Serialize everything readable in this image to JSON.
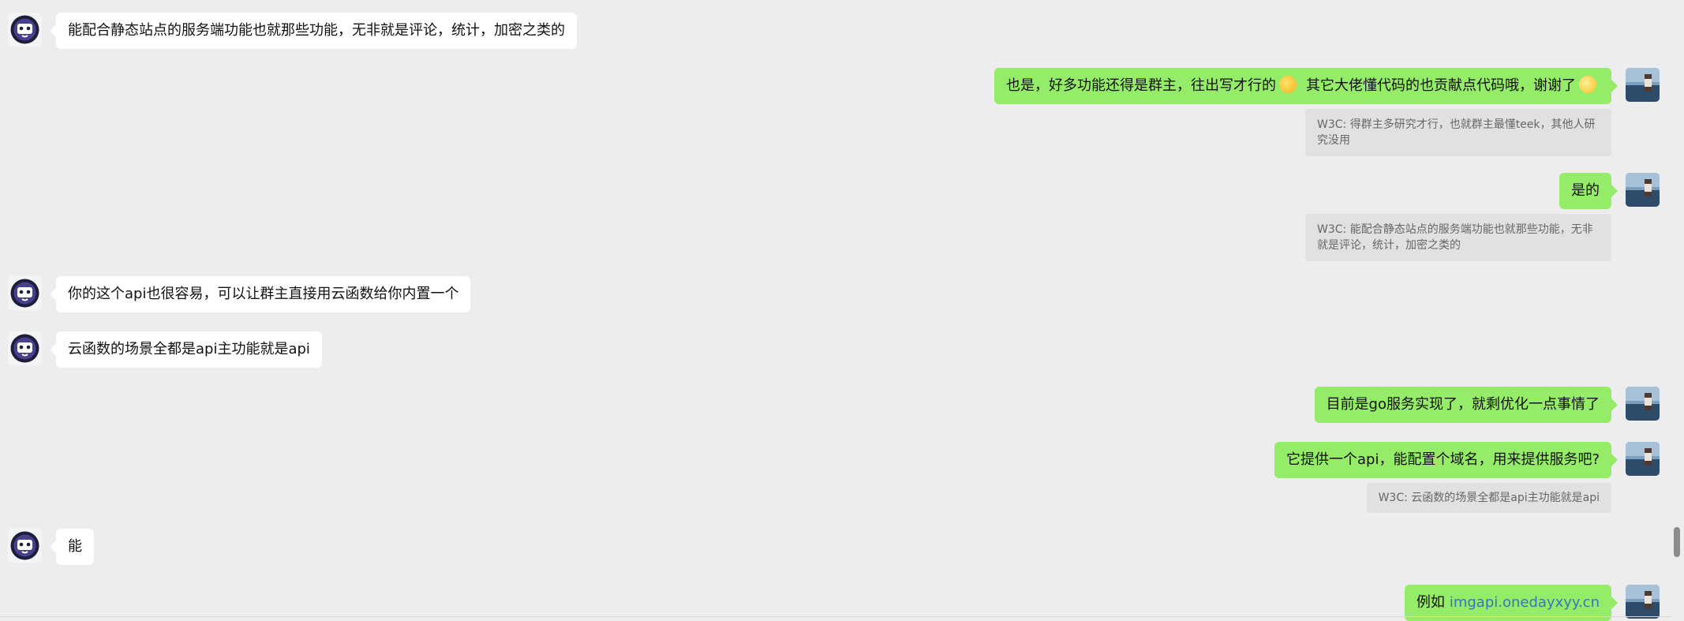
{
  "messages": [
    {
      "side": "left",
      "text": "能配合静态站点的服务端功能也就那些功能，无非就是评论，统计，加密之类的"
    },
    {
      "side": "right",
      "text_a": "也是，好多功能还得是群主，往出写才行的",
      "text_b": "其它大佬懂代码的也贡献点代码哦，谢谢了",
      "emoji_a": "grinning-sweat-emoji",
      "emoji_b": "smiling-face-emoji"
    },
    {
      "side": "quote",
      "text": "W3C: 得群主多研究才行，也就群主最懂teek，其他人研究没用"
    },
    {
      "side": "right",
      "text": "是的"
    },
    {
      "side": "quote",
      "text": "W3C: 能配合静态站点的服务端功能也就那些功能，无非就是评论，统计，加密之类的"
    },
    {
      "side": "left",
      "text": "你的这个api也很容易，可以让群主直接用云函数给你内置一个"
    },
    {
      "side": "left",
      "text": "云函数的场景全都是api主功能就是api"
    },
    {
      "side": "right",
      "text": "目前是go服务实现了，就剩优化一点事情了"
    },
    {
      "side": "right",
      "text": "它提供一个api，能配置个域名，用来提供服务吧?"
    },
    {
      "side": "quote",
      "text": "W3C: 云函数的场景全都是api主功能就是api"
    },
    {
      "side": "left",
      "text": "能"
    },
    {
      "side": "right",
      "text": "例如",
      "link": "imgapi.onedayxyy.cn"
    }
  ],
  "colors": {
    "self_bubble": "#95ec69",
    "other_bubble": "#ffffff",
    "quote_bg": "#e1e1e1",
    "background": "#ededed",
    "link": "#3b74b8"
  }
}
